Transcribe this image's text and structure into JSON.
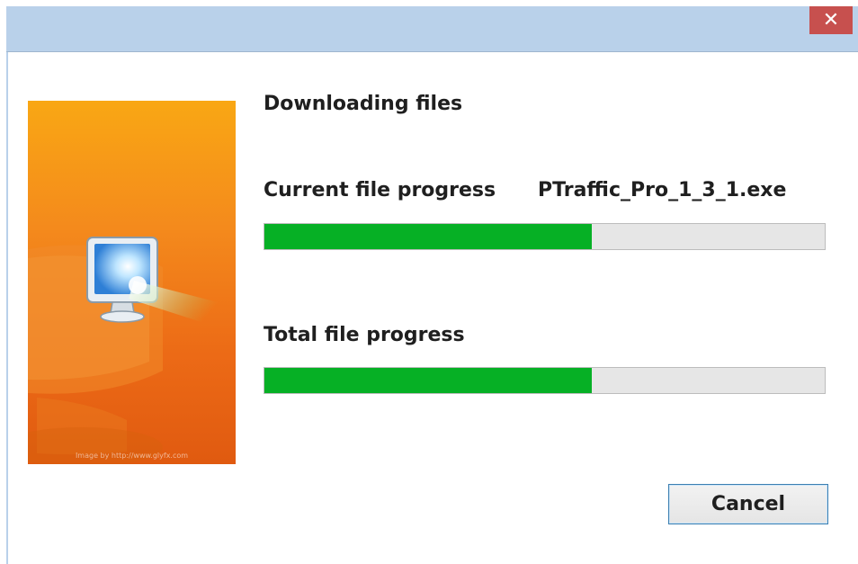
{
  "window": {
    "close_glyph": "✕"
  },
  "side_image": {
    "credit": "Image by http://www.glyfx.com"
  },
  "main": {
    "heading": "Downloading files",
    "current_label": "Current file progress",
    "current_file": "PTraffic_Pro_1_3_1.exe",
    "current_progress": 0.585,
    "total_label": "Total file progress",
    "total_progress": 0.585
  },
  "buttons": {
    "cancel_label": "Cancel"
  },
  "colors": {
    "titlebar": "#b9d1ea",
    "close_button": "#c7504e",
    "progress_fill": "#06b025",
    "progress_track": "#e6e6e6",
    "cancel_border": "#3c7fb1"
  }
}
